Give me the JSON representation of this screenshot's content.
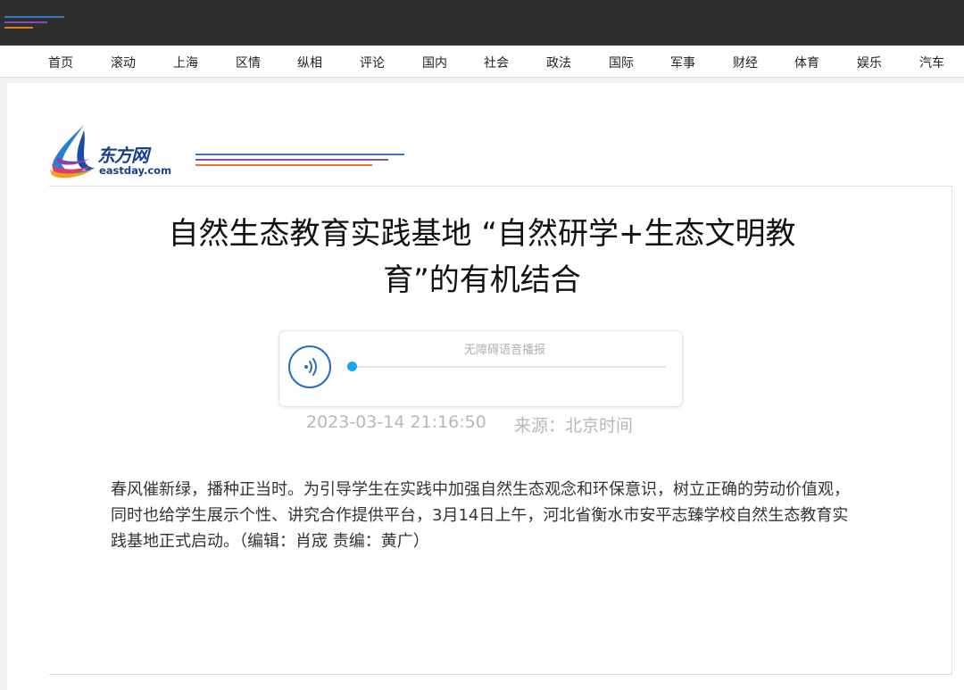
{
  "colors": {
    "topbar": "#2e2e2e",
    "accent_blue": "#1fa3f0",
    "brand_navy": "#1a3f8c"
  },
  "nav": {
    "items": [
      "首页",
      "滚动",
      "上海",
      "区情",
      "纵相",
      "评论",
      "国内",
      "社会",
      "政法",
      "国际",
      "军事",
      "财经",
      "体育",
      "娱乐",
      "汽车"
    ]
  },
  "logo": {
    "name": "东方网",
    "domain": "eastday.com",
    "icon": "eastday-flame-logo"
  },
  "article": {
    "title_line1": "自然生态教育实践基地 “自然研学+生态文明教",
    "title_line2": "育”的有机结合",
    "date": "2023-03-14 21:16:50",
    "source": "来源：北京时间",
    "body": "春风催新绿，播种正当时。为引导学生在实践中加强自然生态观念和环保意识，树立正确的劳动价值观，同时也给学生展示个性、讲究合作提供平台，3月14日上午，河北省衡水市安平志臻学校自然生态教育实践基地正式启动。（编辑：肖宬 责编：黄广）"
  },
  "player": {
    "label": "无障碍语音播报",
    "progress": 0,
    "icon": "audio-wave-icon"
  }
}
